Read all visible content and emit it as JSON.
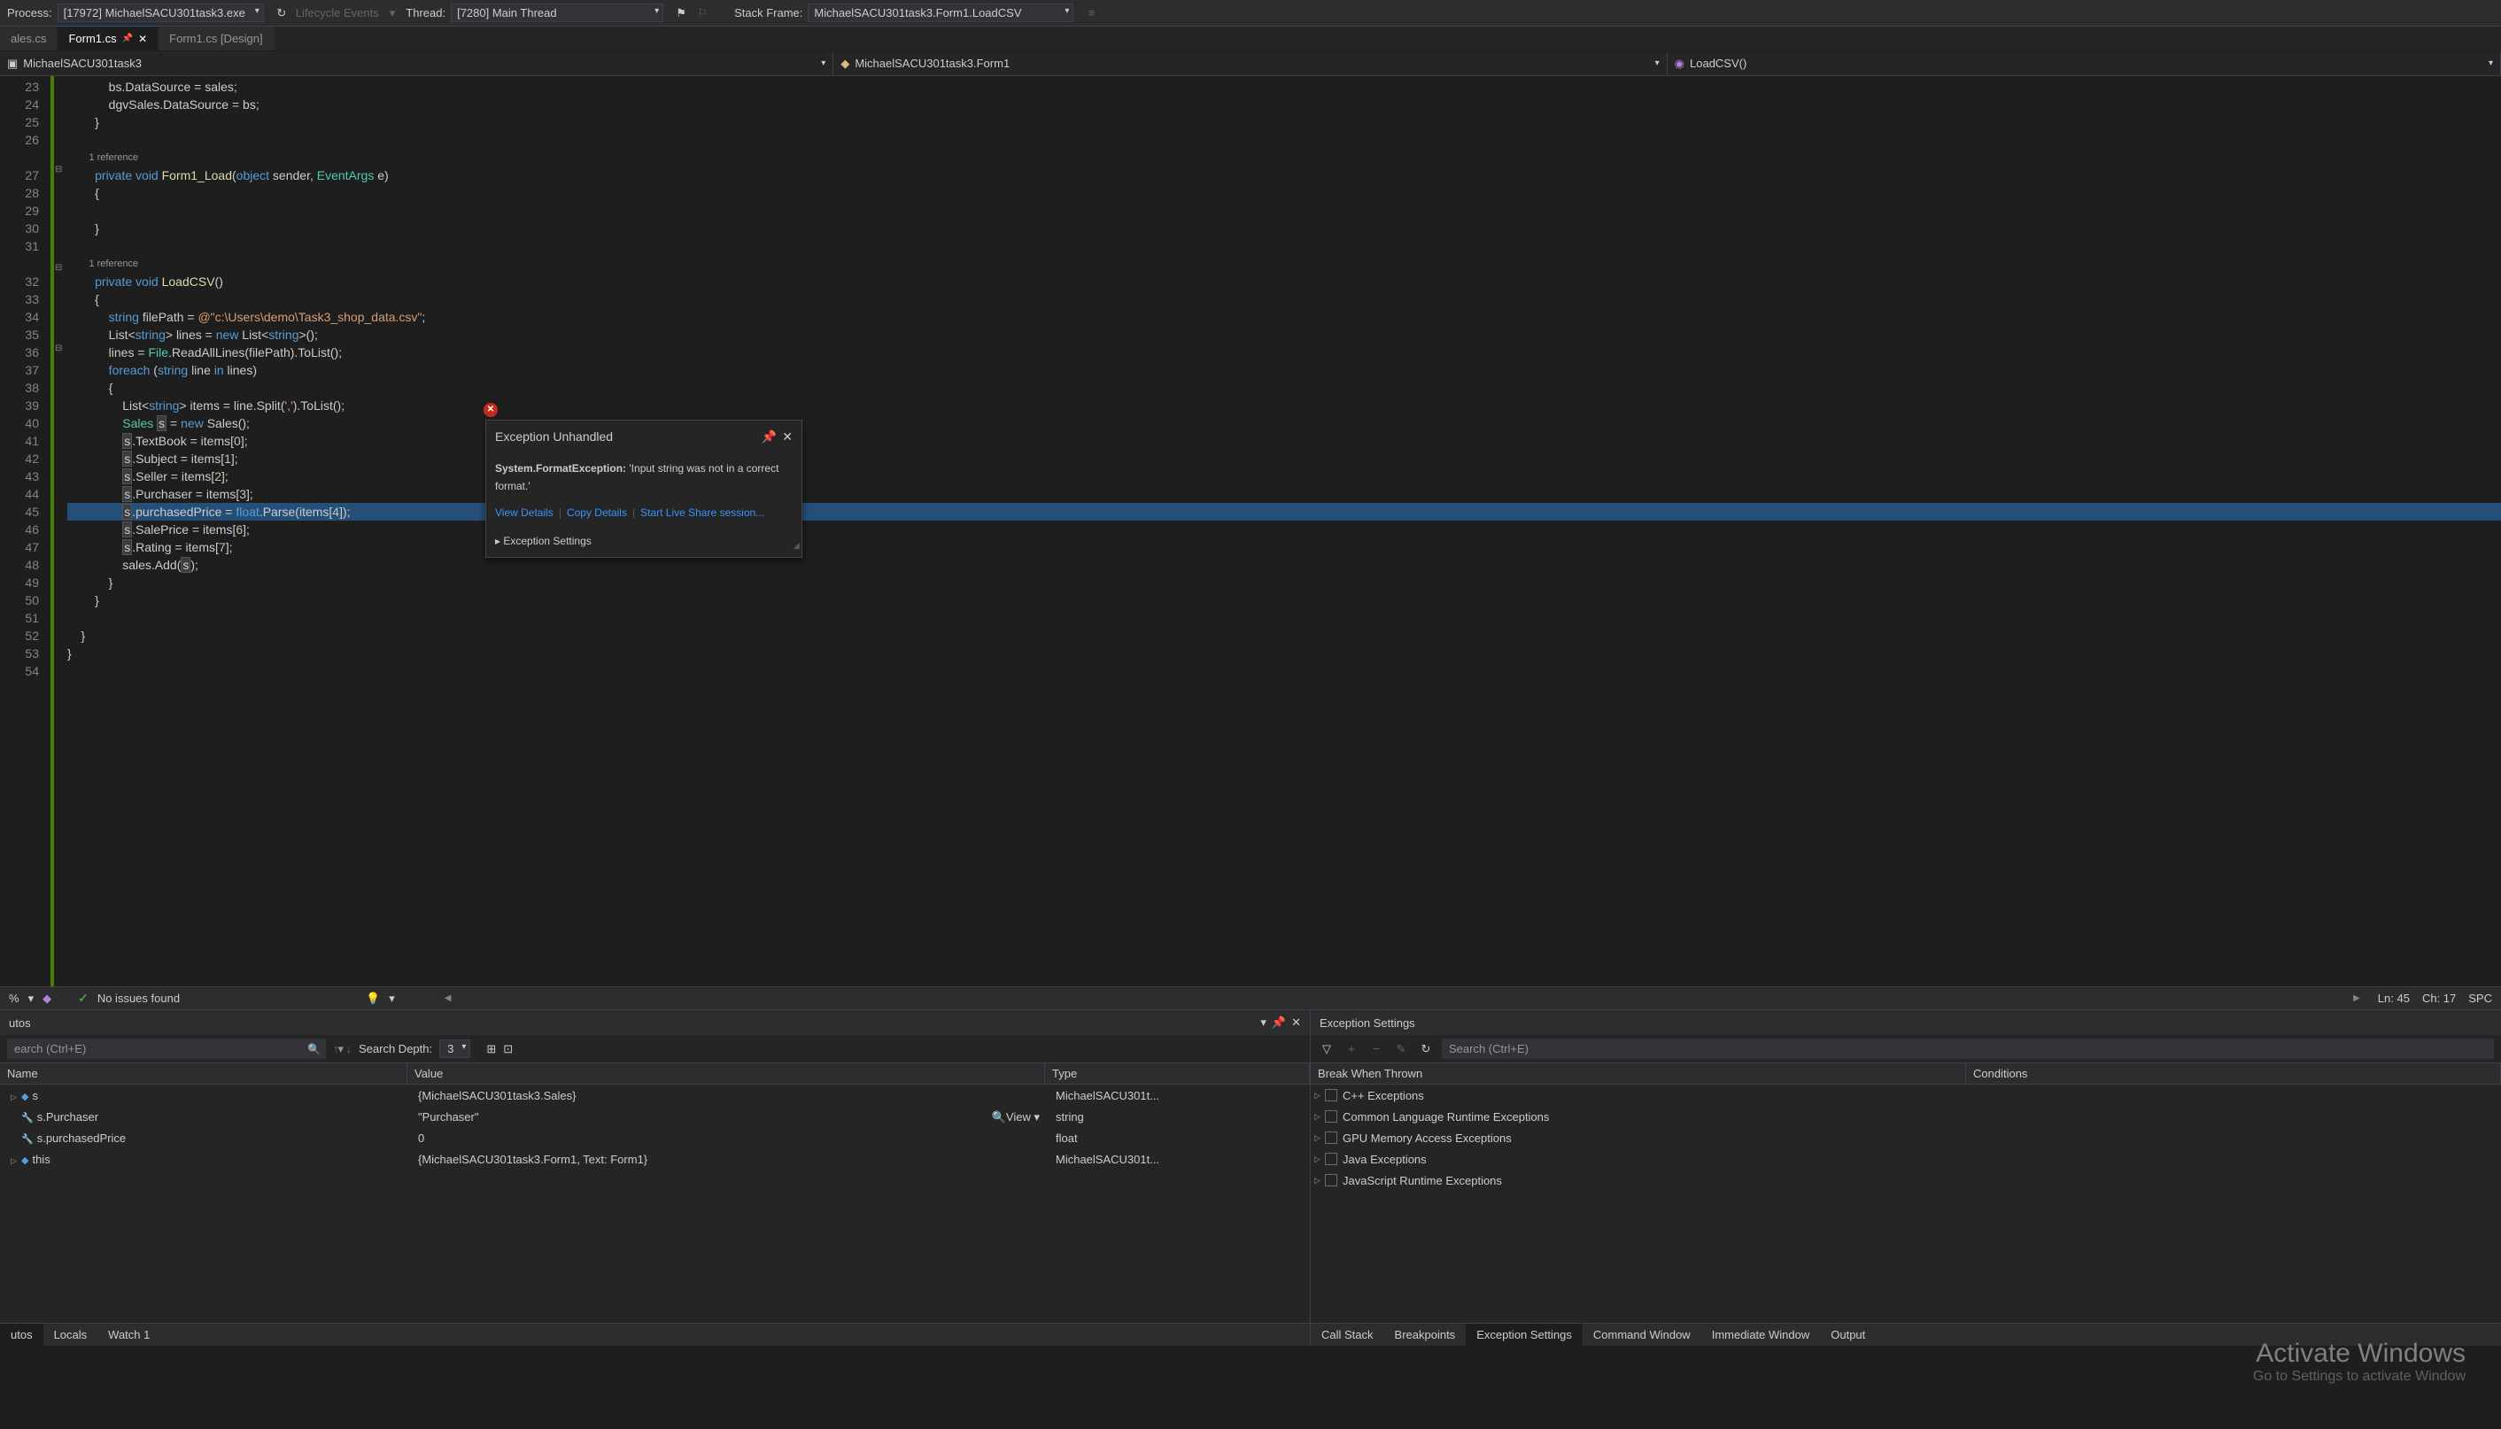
{
  "toolbar": {
    "process_label": "Process:",
    "process_value": "[17972] MichaelSACU301task3.exe",
    "lifecycle_label": "Lifecycle Events",
    "thread_label": "Thread:",
    "thread_value": "[7280] Main Thread",
    "stackframe_label": "Stack Frame:",
    "stackframe_value": "MichaelSACU301task3.Form1.LoadCSV"
  },
  "tabs": {
    "design_tab": "ales.cs",
    "form1_tab": "Form1.cs",
    "form1_design_tab": "Form1.cs [Design]"
  },
  "nav": {
    "project": "MichaelSACU301task3",
    "class": "MichaelSACU301task3.Form1",
    "method": "LoadCSV()"
  },
  "code_lines": {
    "l23": "            bs.DataSource = sales;",
    "l24": "            dgvSales.DataSource = bs;",
    "l25": "        }",
    "l26": "",
    "ref1": "        1 reference",
    "l27_a": "        private ",
    "l27_b": "void ",
    "l27_c": "Form1_Load",
    "l27_d": "(",
    "l27_e": "object ",
    "l27_f": "sender, ",
    "l27_g": "EventArgs ",
    "l27_h": "e)",
    "l28": "        {",
    "l29": "",
    "l30": "        }",
    "l31": "",
    "ref2": "        1 reference",
    "l32_a": "        private ",
    "l32_b": "void ",
    "l32_c": "LoadCSV",
    "l32_d": "()",
    "l33": "        {",
    "l34_a": "            string ",
    "l34_b": "filePath = ",
    "l34_c": "@\"c:\\Users\\demo\\Task3_shop_data.csv\"",
    "l34_d": ";",
    "l35_a": "            List<",
    "l35_b": "string",
    "l35_c": "> lines = ",
    "l35_d": "new ",
    "l35_e": "List<",
    "l35_f": "string",
    "l35_g": ">();",
    "l36_a": "            lines = ",
    "l36_b": "File",
    "l36_c": ".ReadAllLines(filePath).ToList();",
    "l37_a": "            foreach ",
    "l37_b": "(",
    "l37_c": "string ",
    "l37_d": "line ",
    "l37_e": "in ",
    "l37_f": "lines)",
    "l38": "            {",
    "l39_a": "                List<",
    "l39_b": "string",
    "l39_c": "> items = line.Split(",
    "l39_d": "','",
    "l39_e": ").ToList();",
    "l40_a": "                Sales ",
    "l40_b": "s",
    "l40_c": " = ",
    "l40_d": "new ",
    "l40_e": "Sales();",
    "l41_a": "                ",
    "l41_b": "s",
    "l41_c": ".TextBook = items[",
    "l41_d": "0",
    "l41_e": "];",
    "l42_a": "                ",
    "l42_b": "s",
    "l42_c": ".Subject = items[",
    "l42_d": "1",
    "l42_e": "];",
    "l43_a": "                ",
    "l43_b": "s",
    "l43_c": ".Seller = items[",
    "l43_d": "2",
    "l43_e": "];",
    "l44_a": "                ",
    "l44_b": "s",
    "l44_c": ".Purchaser = items[",
    "l44_d": "3",
    "l44_e": "];",
    "l45_a": "                ",
    "l45_b": "s",
    "l45_c": ".purchasedPrice = ",
    "l45_d": "float",
    "l45_e": ".Parse(items[",
    "l45_f": "4",
    "l45_g": "]);",
    "l46_a": "                ",
    "l46_b": "s",
    "l46_c": ".SalePrice = items[",
    "l46_d": "6",
    "l46_e": "];",
    "l47_a": "                ",
    "l47_b": "s",
    "l47_c": ".Rating = items[",
    "l47_d": "7",
    "l47_e": "];",
    "l48_a": "                sales.Add(",
    "l48_b": "s",
    "l48_c": ");",
    "l49": "            }",
    "l50": "        }",
    "l51": "",
    "l52": "    }",
    "l53": "}",
    "l54": ""
  },
  "line_numbers": [
    "23",
    "24",
    "25",
    "26",
    "27",
    "28",
    "29",
    "30",
    "31",
    "32",
    "33",
    "34",
    "35",
    "36",
    "37",
    "38",
    "39",
    "40",
    "41",
    "42",
    "43",
    "44",
    "45",
    "46",
    "47",
    "48",
    "49",
    "50",
    "51",
    "52",
    "53",
    "54"
  ],
  "exception": {
    "title": "Exception Unhandled",
    "type": "System.FormatException:",
    "message": "'Input string was not in a correct format.'",
    "link_details": "View Details",
    "link_copy": "Copy Details",
    "link_liveshare": "Start Live Share session...",
    "settings": "Exception Settings"
  },
  "status": {
    "percent": "%",
    "issues": "No issues found",
    "ln": "Ln: 45",
    "ch": "Ch: 17",
    "spc": "SPC"
  },
  "autos": {
    "title": "utos",
    "search_placeholder": "earch (Ctrl+E)",
    "search_depth_label": "Search Depth:",
    "search_depth_value": "3",
    "col_name": "Name",
    "col_value": "Value",
    "col_type": "Type",
    "rows": [
      {
        "name": "s",
        "value": "{MichaelSACU301task3.Sales}",
        "type": "MichaelSACU301t..."
      },
      {
        "name": "s.Purchaser",
        "value": "\"Purchaser\"",
        "type": "string",
        "view": "View"
      },
      {
        "name": "s.purchasedPrice",
        "value": "0",
        "type": "float"
      },
      {
        "name": "this",
        "value": "{MichaelSACU301task3.Form1, Text: Form1}",
        "type": "MichaelSACU301t..."
      }
    ]
  },
  "exception_settings": {
    "title": "Exception Settings",
    "search_placeholder": "Search (Ctrl+E)",
    "col_break": "Break When Thrown",
    "col_conditions": "Conditions",
    "categories": [
      "C++ Exceptions",
      "Common Language Runtime Exceptions",
      "GPU Memory Access Exceptions",
      "Java Exceptions",
      "JavaScript Runtime Exceptions"
    ]
  },
  "bottom_tabs_left": [
    "utos",
    "Locals",
    "Watch 1"
  ],
  "bottom_tabs_right": [
    "Call Stack",
    "Breakpoints",
    "Exception Settings",
    "Command Window",
    "Immediate Window",
    "Output"
  ],
  "watermark": {
    "title": "Activate Windows",
    "sub": "Go to Settings to activate Window"
  }
}
